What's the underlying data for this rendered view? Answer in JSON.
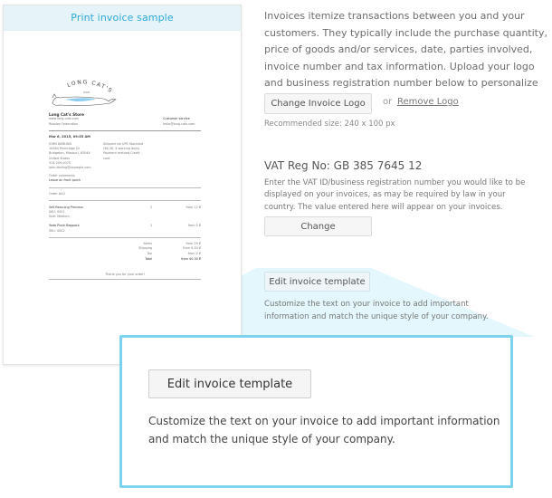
{
  "preview": {
    "link_label": "Print invoice sample",
    "invoice": {
      "logo_text": "LONG CAT'S",
      "logo_subtext": "SHOP",
      "store_name": "Long Cat's Store",
      "website": "www.long-cats.com",
      "country": "Russian Federation",
      "service_label": "Customer service",
      "service_email": "hello@long-cats.com",
      "date": "Mar 6, 2015, 09:55 AM",
      "customer": [
        "JOHN DARLING",
        "10940 Pennridge Dr",
        "Bridgeton, Missouri, 63044",
        "United States",
        "314-209-0075",
        "john.darling@example.com"
      ],
      "shipping": [
        "Shipped via UPS Standard",
        "($6.30, 3 working days)",
        "Payment method Credit card"
      ],
      "comments_label": "Order comments",
      "comments": "Leave on front porch",
      "order_number": "Order #42",
      "items": [
        {
          "name": "Self-Rescuing Princess",
          "details": [
            "SKU: 0001",
            "Size: Medium"
          ],
          "qty": "2",
          "price": "from 12 ₽"
        },
        {
          "name": "Yoda Plush Bagpack",
          "details": [
            "SKU: 0002"
          ],
          "qty": "1",
          "price": "from 5 ₽"
        }
      ],
      "totals": [
        {
          "label": "Items",
          "value": "from 29 ₽"
        },
        {
          "label": "Shipping",
          "value": "from 6.30 ₽"
        },
        {
          "label": "Tax",
          "value": "from 2 ₽"
        },
        {
          "label": "Total",
          "value": "from 40.30 ₽"
        }
      ],
      "thanks": "Thank you for your order!"
    }
  },
  "intro_text": "Invoices itemize transactions between you and your customers. They typically include the purchase quantity, price of goods and/or services, date, parties involved, invoice number and tax information. Upload your logo and business registration number below to personalize your invoices.",
  "logo": {
    "change_label": "Change Invoice Logo",
    "or_label": "or",
    "remove_label": "Remove Logo",
    "recommended_size": "Recommended size: 240 x 100 px"
  },
  "vat": {
    "title": "VAT Reg No: GB 385 7645 12",
    "description": "Enter the VAT ID/business registration number you would like to be displayed on your invoices, as may be required by law in your country. The value entered here will appear on your invoices.",
    "change_label": "Change"
  },
  "template": {
    "edit_label": "Edit invoice template",
    "description": "Customize the text on your invoice to add important information and match the unique style of your company."
  },
  "colors": {
    "accent": "#2ea8d6",
    "highlight_border": "#7dd3ee",
    "highlight_fill": "#e3f7fc"
  }
}
